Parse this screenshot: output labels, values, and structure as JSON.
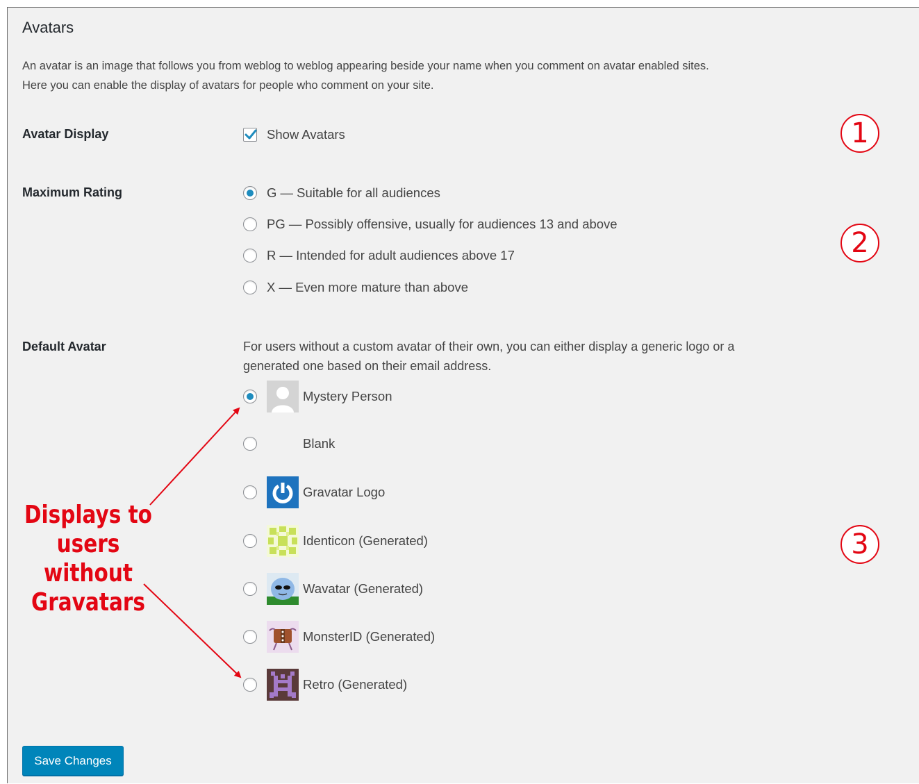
{
  "section": {
    "title": "Avatars",
    "description_line1": "An avatar is an image that follows you from weblog to weblog appearing beside your name when you comment on avatar enabled sites.",
    "description_line2": "Here you can enable the display of avatars for people who comment on your site."
  },
  "avatar_display": {
    "label": "Avatar Display",
    "checkbox_label": "Show Avatars",
    "checked": true
  },
  "maximum_rating": {
    "label": "Maximum Rating",
    "options": [
      {
        "label": "G — Suitable for all audiences",
        "selected": true
      },
      {
        "label": "PG — Possibly offensive, usually for audiences 13 and above",
        "selected": false
      },
      {
        "label": "R — Intended for adult audiences above 17",
        "selected": false
      },
      {
        "label": "X — Even more mature than above",
        "selected": false
      }
    ]
  },
  "default_avatar": {
    "label": "Default Avatar",
    "help_line1": "For users without a custom avatar of their own, you can either display a generic logo or a",
    "help_line2": "generated one based on their email address.",
    "options": [
      {
        "label": "Mystery Person",
        "icon": "mystery-person-avatar",
        "selected": true
      },
      {
        "label": "Blank",
        "icon": "blank-avatar",
        "selected": false
      },
      {
        "label": "Gravatar Logo",
        "icon": "gravatar-logo-avatar",
        "selected": false
      },
      {
        "label": "Identicon (Generated)",
        "icon": "identicon-avatar",
        "selected": false
      },
      {
        "label": "Wavatar (Generated)",
        "icon": "wavatar-avatar",
        "selected": false
      },
      {
        "label": "MonsterID (Generated)",
        "icon": "monsterid-avatar",
        "selected": false
      },
      {
        "label": "Retro (Generated)",
        "icon": "retro-avatar",
        "selected": false
      }
    ]
  },
  "save_button": {
    "label": "Save Changes"
  },
  "annotations": {
    "callout_line1": "Displays to",
    "callout_line2": "users without",
    "callout_line3": "Gravatars",
    "markers": [
      "1",
      "2",
      "3"
    ],
    "color": "#e30613"
  },
  "colors": {
    "accent": "#0085ba",
    "radio_dot": "#1e8cbe",
    "panel_bg": "#f1f1f1"
  }
}
